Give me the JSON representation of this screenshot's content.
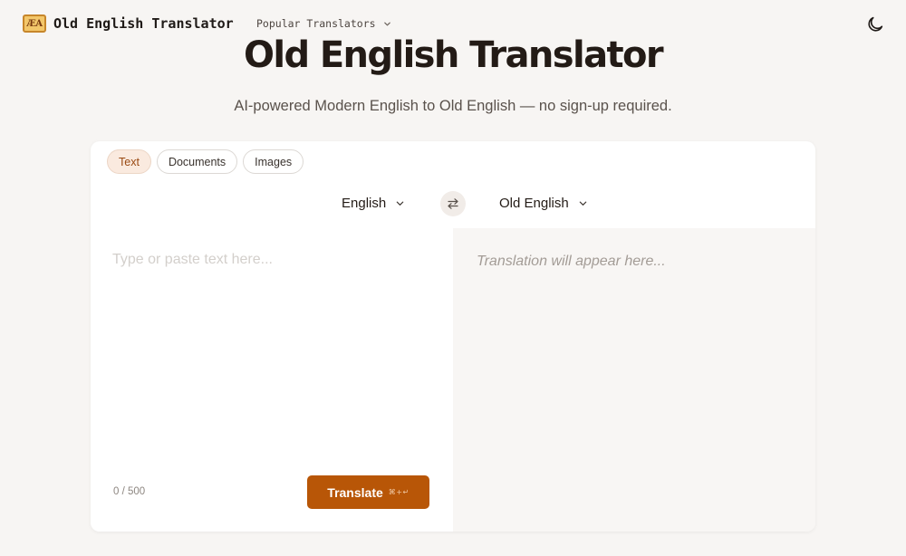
{
  "header": {
    "logo_mark": "ÆA",
    "logo_text": "Old English Translator",
    "nav_popular": "Popular Translators",
    "theme_icon": "moon-icon"
  },
  "hero": {
    "title": "Old English Translator",
    "subtitle": "AI-powered Modern English to Old English — no sign-up required."
  },
  "tabs": [
    {
      "label": "Text",
      "active": true
    },
    {
      "label": "Documents",
      "active": false
    },
    {
      "label": "Images",
      "active": false
    }
  ],
  "languages": {
    "source": "English",
    "target": "Old English",
    "swap_icon": "swap-arrows-icon"
  },
  "input": {
    "placeholder": "Type or paste text here...",
    "value": "",
    "counter": "0 / 500"
  },
  "output": {
    "placeholder": "Translation will appear here..."
  },
  "translate": {
    "label": "Translate",
    "shortcut": "⌘+↵"
  },
  "colors": {
    "accent": "#b85607",
    "background": "#f7f5f3",
    "active_tab_bg": "#faeadf"
  }
}
